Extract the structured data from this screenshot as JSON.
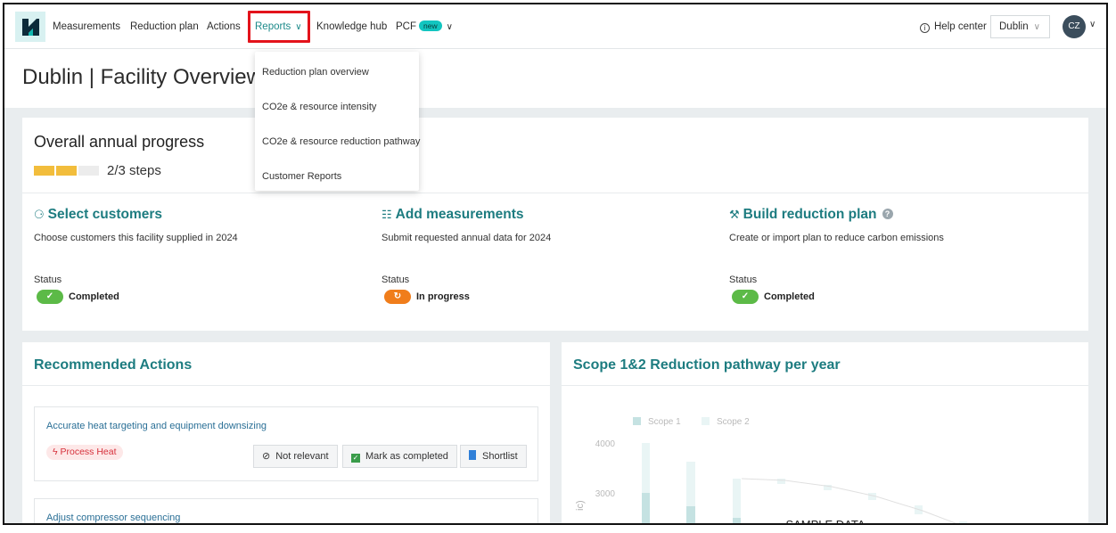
{
  "nav": {
    "items": [
      "Measurements",
      "Reduction plan",
      "Actions"
    ],
    "reports_label": "Reports",
    "knowledge_label": "Knowledge hub",
    "pcf_label": "PCF",
    "pcf_badge": "new",
    "help_label": "Help center",
    "facility_select": "Dublin",
    "avatar_initials": "CZ"
  },
  "reports_menu": {
    "items": [
      "Reduction plan overview",
      "CO2e & resource intensity",
      "CO2e & resource reduction pathway",
      "Customer Reports"
    ]
  },
  "page": {
    "title": "Dublin | Facility Overview"
  },
  "progress": {
    "title": "Overall annual progress",
    "steps_text": "2/3 steps",
    "completed_steps": 2,
    "total_steps": 3,
    "colors": {
      "done": "#f2bd3c",
      "todo": "#ececec"
    },
    "cards": [
      {
        "title": "Select customers",
        "icon": "person-icon",
        "description": "Choose customers this facility supplied in 2024",
        "status_label": "Status",
        "status": "Completed",
        "status_color": "#5cba47"
      },
      {
        "title": "Add measurements",
        "icon": "document-icon",
        "description": "Submit requested annual data for 2024",
        "status_label": "Status",
        "status": "In progress",
        "status_color": "#f07d1b"
      },
      {
        "title": "Build reduction plan",
        "icon": "wrench-icon",
        "description": "Create or import plan to reduce carbon emissions",
        "status_label": "Status",
        "status": "Completed",
        "status_color": "#5cba47"
      }
    ]
  },
  "recommended": {
    "title": "Recommended Actions",
    "items": [
      {
        "title": "Accurate heat targeting and equipment downsizing",
        "tag": "Process Heat",
        "not_relevant": "Not relevant",
        "mark_completed": "Mark as completed",
        "shortlist": "Shortlist"
      },
      {
        "title": "Adjust compressor sequencing"
      }
    ]
  },
  "chart": {
    "title": "Scope 1&2 Reduction pathway per year",
    "legend": [
      "Scope 1",
      "Scope 2"
    ],
    "yticks": [
      "4000",
      "3000"
    ],
    "ylabel_fragment": "ic)",
    "watermark": "SAMPLE DATA",
    "colors": {
      "scope1": "#7fc1c1",
      "scope2": "#cfeaea"
    }
  },
  "chart_data": {
    "type": "bar",
    "series": [
      {
        "name": "Scope 1"
      },
      {
        "name": "Scope 2"
      }
    ],
    "yticks": [
      4000,
      3000
    ]
  }
}
